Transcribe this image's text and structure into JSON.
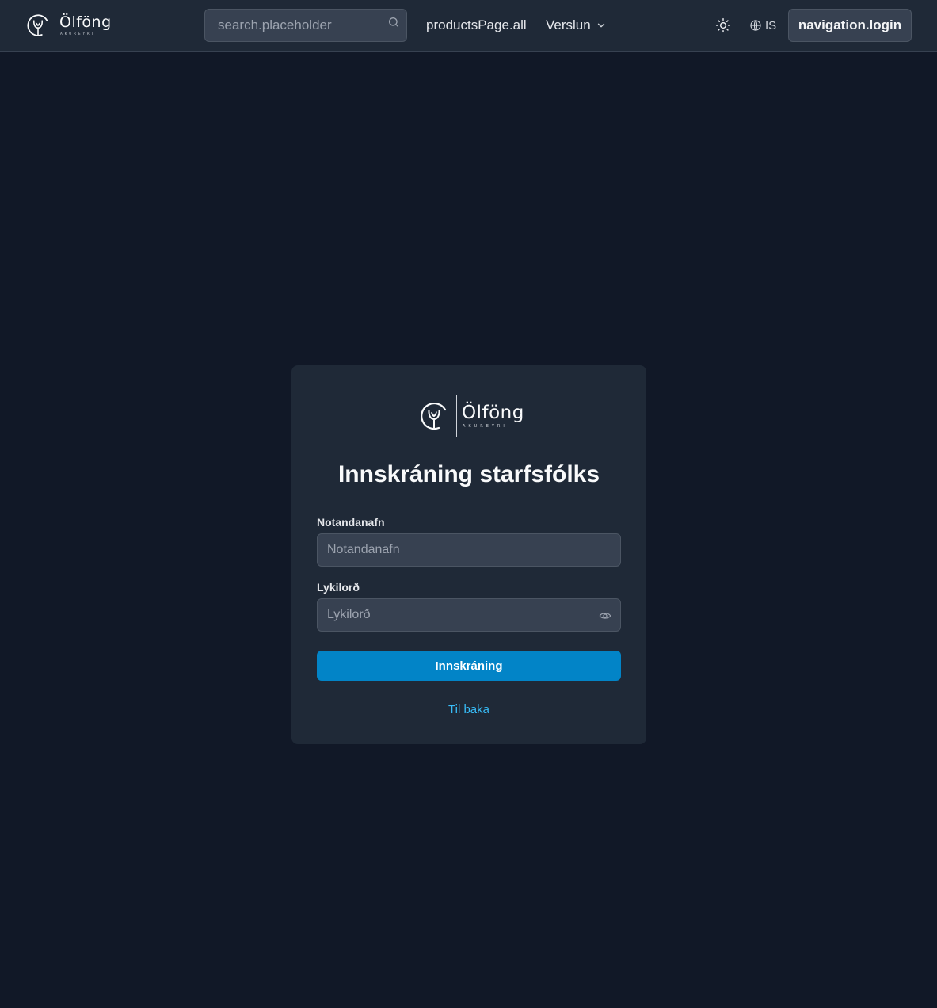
{
  "header": {
    "logo": {
      "word": "Ölföng",
      "sub": "AKUREYRI"
    },
    "search": {
      "placeholder": "search.placeholder"
    },
    "nav": {
      "all_products": "productsPage.all",
      "store": "Verslun"
    },
    "language": "IS",
    "login_label": "navigation.login"
  },
  "login_card": {
    "logo": {
      "word": "Ölföng",
      "sub": "AKUREYRI"
    },
    "title": "Innskráning starfsfólks",
    "username": {
      "label": "Notandanafn",
      "placeholder": "Notandanafn"
    },
    "password": {
      "label": "Lykilorð",
      "placeholder": "Lykilorð"
    },
    "submit_label": "Innskráning",
    "back_label": "Til baka"
  },
  "colors": {
    "background": "#111827",
    "header": "#1f2937",
    "card": "#1f2937",
    "input": "#374151",
    "primary_button": "#0284c7",
    "link": "#38bdf8"
  },
  "icons": {
    "search": "search-icon",
    "store_dropdown": "chevron-down-icon",
    "theme": "sun-icon",
    "language": "globe-icon",
    "password_toggle": "eye-icon"
  }
}
